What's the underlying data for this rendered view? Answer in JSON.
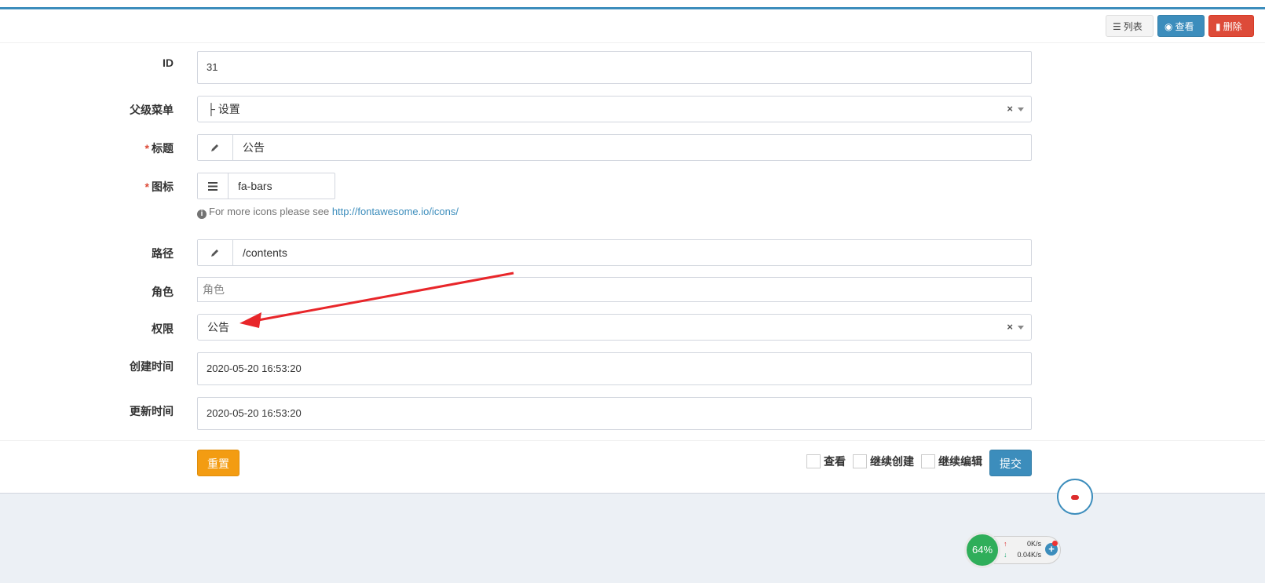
{
  "toolbar": {
    "list_label": "列表",
    "view_label": "查看",
    "delete_label": "删除"
  },
  "form": {
    "id": {
      "label": "ID",
      "value": "31"
    },
    "parent_menu": {
      "label": "父级菜单",
      "value": "├ 设置"
    },
    "title": {
      "label": "标题",
      "required_mark": "*",
      "value": "公告"
    },
    "icon": {
      "label": "图标",
      "required_mark": "*",
      "value": "fa-bars",
      "help_prefix": "For more icons please see",
      "help_link": "http://fontawesome.io/icons/"
    },
    "path": {
      "label": "路径",
      "value": "/contents"
    },
    "role": {
      "label": "角色",
      "placeholder": "角色"
    },
    "permission": {
      "label": "权限",
      "value": "公告"
    },
    "created_at": {
      "label": "创建时间",
      "value": "2020-05-20 16:53:20"
    },
    "updated_at": {
      "label": "更新时间",
      "value": "2020-05-20 16:53:20"
    }
  },
  "footer": {
    "reset_label": "重置",
    "submit_label": "提交",
    "check_view": "查看",
    "check_continue_create": "继续创建",
    "check_continue_edit": "继续编辑"
  },
  "widget": {
    "percent": "64%",
    "upload": "0K/s",
    "download": "0.04K/s"
  },
  "colors": {
    "primary": "#3c8dbc",
    "danger": "#dd4b39",
    "warning": "#f39c12",
    "annotation_arrow": "#e8262a"
  }
}
